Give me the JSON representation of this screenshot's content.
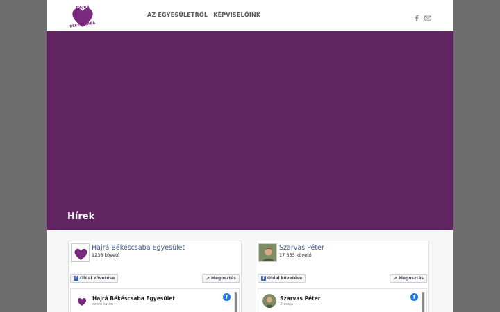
{
  "header": {
    "logo": {
      "line1": "HAJRÁ",
      "line2": "BÉKÉSCSABA",
      "color": "#7a2a7e"
    },
    "nav": [
      {
        "label": "AZ EGYESÜLETRŐL"
      },
      {
        "label": "KÉPVISELŐINK"
      }
    ],
    "icons": [
      "facebook-icon",
      "mail-icon"
    ]
  },
  "hero": {
    "title": "Hírek",
    "background": "#612562"
  },
  "widgets": [
    {
      "page_name": "Hajrá Békéscsaba Egyesület",
      "followers": "1236 követő",
      "follow_label": "Oldal követése",
      "share_label": "Megosztás",
      "post": {
        "author": "Hajrá Békéscsaba Egyesület",
        "time": "szombaton"
      }
    },
    {
      "page_name": "Szarvas Péter",
      "followers": "17 335 követő",
      "follow_label": "Oldal követése",
      "share_label": "Megosztás",
      "post": {
        "author": "Szarvas Péter",
        "time": "2 órája"
      }
    }
  ],
  "colors": {
    "brand": "#612562",
    "facebook": "#1877f2",
    "fb_link": "#3b5998"
  }
}
